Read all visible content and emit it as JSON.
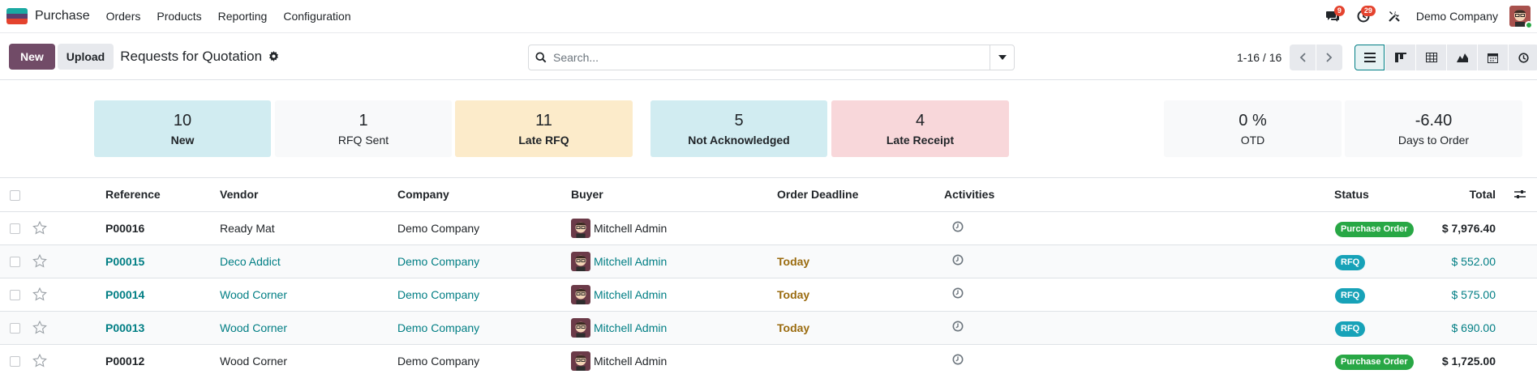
{
  "app": {
    "name": "Purchase",
    "menu": [
      "Orders",
      "Products",
      "Reporting",
      "Configuration"
    ],
    "colors": {
      "accent": "#714b67",
      "link": "#017e84",
      "icon_top": "#1aa9a2",
      "icon_mid": "#5a3e70",
      "icon_bot": "#e4432e"
    }
  },
  "navbar": {
    "messages_count": "9",
    "activities_count": "29",
    "company": "Demo Company"
  },
  "control": {
    "new_label": "New",
    "upload_label": "Upload",
    "title": "Requests for Quotation",
    "search_placeholder": "Search...",
    "pager": "1-16 / 16"
  },
  "dashboard": {
    "cards": [
      {
        "value": "10",
        "label": "New",
        "bg": "#d1ecf1"
      },
      {
        "value": "1",
        "label": "RFQ Sent",
        "bg": "#f8f9fa"
      },
      {
        "value": "11",
        "label": "Late RFQ",
        "bg": "#fcebca"
      },
      {
        "value": "5",
        "label": "Not Acknowledged",
        "bg": "#d1ecf1"
      },
      {
        "value": "4",
        "label": "Late Receipt",
        "bg": "#f8d7da"
      }
    ],
    "kpis": [
      {
        "value": "0 %",
        "label": "OTD"
      },
      {
        "value": "-6.40",
        "label": "Days to Order"
      }
    ]
  },
  "table": {
    "headers": {
      "reference": "Reference",
      "vendor": "Vendor",
      "company": "Company",
      "buyer": "Buyer",
      "deadline": "Order Deadline",
      "activities": "Activities",
      "total": "Total",
      "status": "Status"
    },
    "rows": [
      {
        "reference": "P00016",
        "vendor": "Ready Mat",
        "company": "Demo Company",
        "buyer": "Mitchell Admin",
        "deadline": "",
        "total": "$ 7,976.40",
        "status": "Purchase Order"
      },
      {
        "reference": "P00015",
        "vendor": "Deco Addict",
        "company": "Demo Company",
        "buyer": "Mitchell Admin",
        "deadline": "Today",
        "total": "$ 552.00",
        "status": "RFQ"
      },
      {
        "reference": "P00014",
        "vendor": "Wood Corner",
        "company": "Demo Company",
        "buyer": "Mitchell Admin",
        "deadline": "Today",
        "total": "$ 575.00",
        "status": "RFQ"
      },
      {
        "reference": "P00013",
        "vendor": "Wood Corner",
        "company": "Demo Company",
        "buyer": "Mitchell Admin",
        "deadline": "Today",
        "total": "$ 690.00",
        "status": "RFQ"
      },
      {
        "reference": "P00012",
        "vendor": "Wood Corner",
        "company": "Demo Company",
        "buyer": "Mitchell Admin",
        "deadline": "",
        "total": "$ 1,725.00",
        "status": "Purchase Order"
      }
    ],
    "status_colors": {
      "Purchase Order": "#28a745",
      "RFQ": "#17a2b8"
    }
  }
}
